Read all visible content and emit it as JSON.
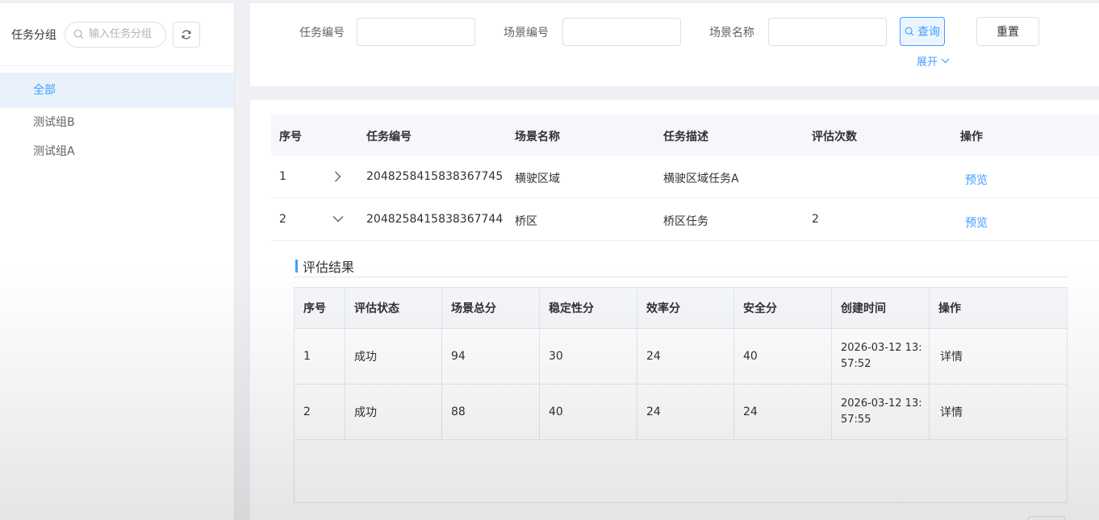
{
  "sidebar": {
    "title": "任务分组",
    "search_placeholder": "输入任务分组",
    "items": [
      {
        "label": "全部"
      },
      {
        "label": "测试组B"
      },
      {
        "label": "测试组A"
      }
    ]
  },
  "filter": {
    "task_no_label": "任务编号",
    "scene_no_label": "场景编号",
    "scene_name_label": "场景名称",
    "query_label": "查询",
    "reset_label": "重置",
    "expand_label": "展开"
  },
  "table": {
    "headers": [
      "序号",
      "任务编号",
      "场景名称",
      "任务描述",
      "评估次数",
      "操作"
    ],
    "rows": [
      {
        "index": "1",
        "task_no": "2048258415838367745",
        "scene_name": "横驶区域",
        "desc": "横驶区域任务A",
        "count": "",
        "action": "预览",
        "expanded": false
      },
      {
        "index": "2",
        "task_no": "2048258415838367744",
        "scene_name": "桥区",
        "desc": "桥区任务",
        "count": "2",
        "action": "预览",
        "expanded": true
      }
    ]
  },
  "eval": {
    "title": "评估结果",
    "headers": [
      "序号",
      "评估状态",
      "场景总分",
      "稳定性分",
      "效率分",
      "安全分",
      "创建时间",
      "操作"
    ],
    "rows": [
      {
        "index": "1",
        "status": "成功",
        "total": "94",
        "stability": "30",
        "efficiency": "24",
        "safety": "40",
        "created": "2026-03-12 13:57:52",
        "action": "详情"
      },
      {
        "index": "2",
        "status": "成功",
        "total": "88",
        "stability": "40",
        "efficiency": "24",
        "safety": "24",
        "created": "2026-03-12 13:57:55",
        "action": "详情"
      }
    ]
  },
  "colors": {
    "accent": "#409eff",
    "active_bg": "#e8f1fc"
  }
}
